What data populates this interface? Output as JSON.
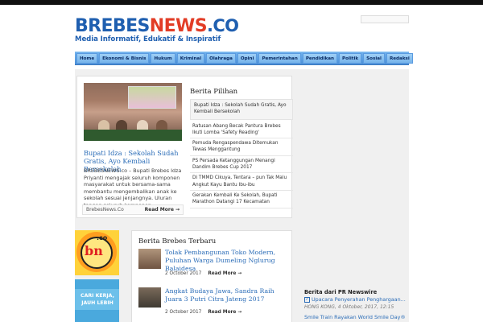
{
  "header": {
    "logo_brebes": "BREBES",
    "logo_news": "NEWS",
    "logo_co": ".CO",
    "tagline": "Media Informatif, Edukatif & Inspiratif"
  },
  "nav": {
    "items": [
      "Home",
      "Ekonomi & Bisnis",
      "Hukum",
      "Kriminal",
      "Olahraga",
      "Opini",
      "Pemerintahan",
      "Pendidikan",
      "Politik",
      "Sosial",
      "Redaksi"
    ]
  },
  "featured": {
    "title": "Bupati Idza : Sekolah Sudah Gratis, Ayo Kembali Bersekolah",
    "excerpt": "BREBESNEWS.co – Bupati Brebes Idza Priyanti mengajak seluruh komponen masyarakat untuk bersama-sama membantu mengembalikan anak ke sekolah sesuai jenjangnya. Uluran tangan seluruh komponen",
    "source": "BrebesNews.Co",
    "more": "Read More →"
  },
  "pilihan": {
    "heading": "Berita Pilihan",
    "items": [
      "Bupati Idza : Sekolah Sudah Gratis, Ayo Kembali Bersekolah",
      "Ratusan Abang Becak Pantura Brebes Ikuti Lomba 'Safety Reading'",
      "Pemuda Rengaspendawa Ditemukan Tewas Menggantung",
      "PS Persada Ketanggungan Menangi Dandim Brebes Cup 2017",
      "Di TMMD Cikuya, Tentara – pun Tak Malu Angkut Kayu Bantu Ibu-ibu",
      "Gerakan Kembali Ke Sekolah, Bupati Marathon Datangi 17 Kecamatan"
    ]
  },
  "sidebar": {
    "banner1_text": "bn",
    "banner1_co": ".co",
    "banner2_text": "CARI KERJA, JAUH LEBIH"
  },
  "terbaru": {
    "heading": "Berita Brebes Terbaru",
    "items": [
      {
        "title": "Tolak Pembangunan Toko Modern, Puluhan Warga Dumeling Nglurug Balaidesa",
        "date": "2 October 2017",
        "more": "Read More →"
      },
      {
        "title": "Angkat Budaya Jawa, Sandra Raih Juara 3 Putri Citra Jateng 2017",
        "date": "2 October 2017",
        "more": "Read More →"
      }
    ]
  },
  "pr": {
    "heading": "Berita dari PR Newswire",
    "item1": "Upacara Penyerahan Penghargaan...",
    "item1_date": "HONG KONG, 4 Oktober, 2017, 12:15",
    "item2": "Smile Train Rayakan World Smile Day®"
  }
}
